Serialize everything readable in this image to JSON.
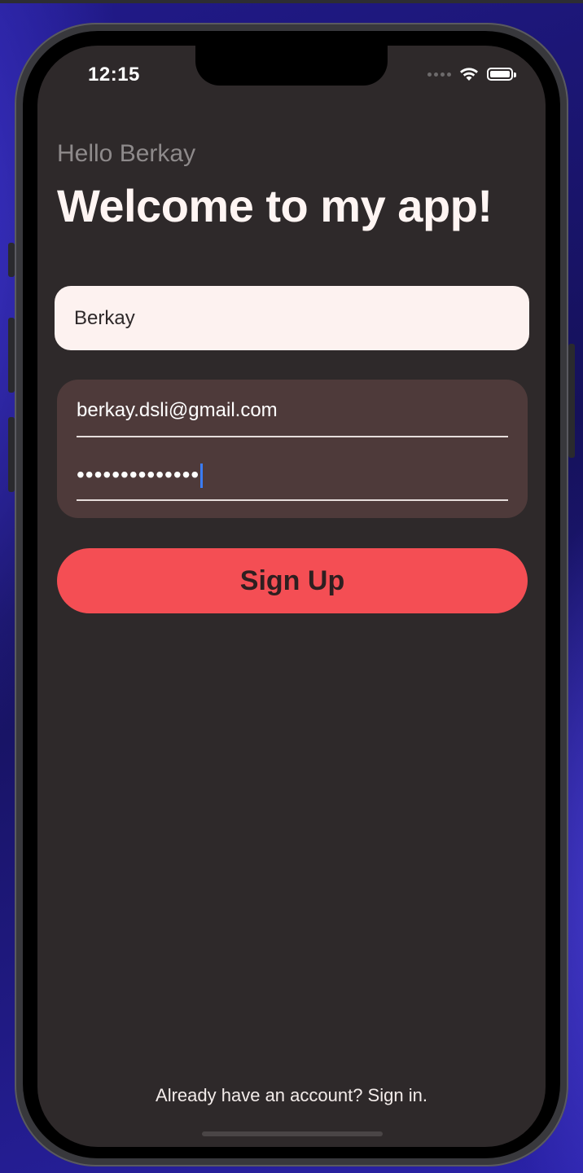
{
  "status_bar": {
    "time": "12:15",
    "icons": [
      "cellular-dots-icon",
      "wifi-icon",
      "battery-icon"
    ]
  },
  "header": {
    "greeting": "Hello Berkay",
    "title": "Welcome to my app!"
  },
  "form": {
    "name_value": "Berkay",
    "email_value": "berkay.dsli@gmail.com",
    "password_mask": "••••••••••••••",
    "signup_label": "Sign Up"
  },
  "footer": {
    "signin_text": "Already have an account? Sign in."
  },
  "colors": {
    "background": "#2e292a",
    "accent": "#f44e54",
    "card": "#4e3a3a",
    "field": "#fdf2f0"
  }
}
